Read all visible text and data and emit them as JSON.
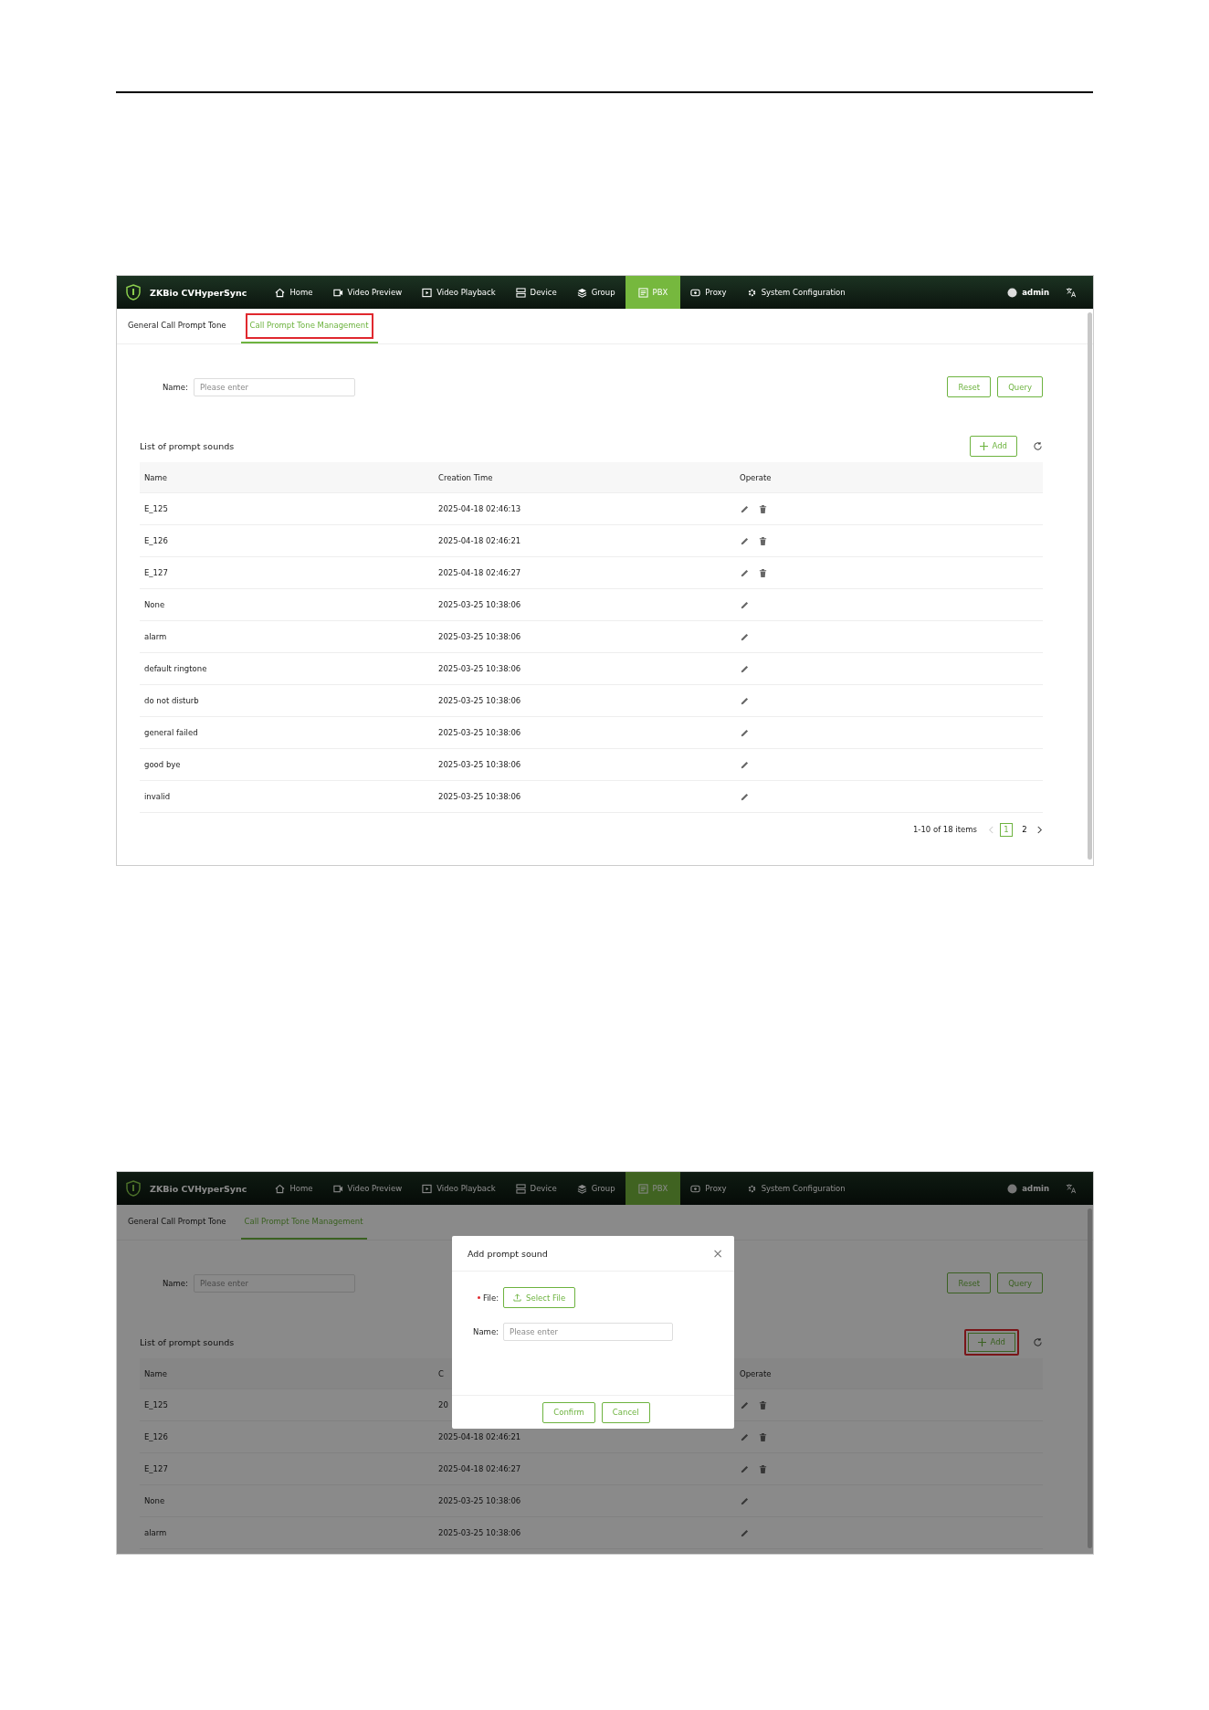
{
  "screens": [
    {
      "brand": "ZKBio CVHyperSync",
      "user": "admin",
      "overlay": false,
      "nav": [
        {
          "label": "Home",
          "selected": false
        },
        {
          "label": "Video Preview",
          "selected": false
        },
        {
          "label": "Video Playback",
          "selected": false
        },
        {
          "label": "Device",
          "selected": false
        },
        {
          "label": "Group",
          "selected": false
        },
        {
          "label": "PBX",
          "selected": true
        },
        {
          "label": "Proxy",
          "selected": false
        },
        {
          "label": "System Configuration",
          "selected": false
        }
      ],
      "tabs": [
        {
          "label": "General Call Prompt Tone",
          "selected": false,
          "highlighted": false
        },
        {
          "label": "Call Prompt Tone Management",
          "selected": true,
          "highlighted": true
        }
      ],
      "filter": {
        "label": "Name:",
        "placeholder": "Please enter"
      },
      "buttons": [
        "Reset",
        "Query"
      ],
      "list_title": "List of prompt sounds",
      "add_button": {
        "label": "Add",
        "highlighted": false
      },
      "columns": [
        "Name",
        "Creation Time",
        "Operate"
      ],
      "rows": [
        {
          "name": "E_125",
          "creation_time": "2025-04-18 02:46:13",
          "deletable": true
        },
        {
          "name": "E_126",
          "creation_time": "2025-04-18 02:46:21",
          "deletable": true
        },
        {
          "name": "E_127",
          "creation_time": "2025-04-18 02:46:27",
          "deletable": true
        },
        {
          "name": "None",
          "creation_time": "2025-03-25 10:38:06",
          "deletable": false
        },
        {
          "name": "alarm",
          "creation_time": "2025-03-25 10:38:06",
          "deletable": false
        },
        {
          "name": "default ringtone",
          "creation_time": "2025-03-25 10:38:06",
          "deletable": false
        },
        {
          "name": "do not disturb",
          "creation_time": "2025-03-25 10:38:06",
          "deletable": false
        },
        {
          "name": "general failed",
          "creation_time": "2025-03-25 10:38:06",
          "deletable": false
        },
        {
          "name": "good bye",
          "creation_time": "2025-03-25 10:38:06",
          "deletable": false
        },
        {
          "name": "invalid",
          "creation_time": "2025-03-25 10:38:06",
          "deletable": false
        }
      ],
      "pagination": {
        "summary": "1-10 of 18 items",
        "pages": [
          {
            "label": "1",
            "selected": true
          },
          {
            "label": "2",
            "selected": false
          }
        ]
      }
    },
    {
      "brand": "ZKBio CVHyperSync",
      "user": "admin",
      "overlay": true,
      "nav": [
        {
          "label": "Home",
          "selected": false
        },
        {
          "label": "Video Preview",
          "selected": false
        },
        {
          "label": "Video Playback",
          "selected": false
        },
        {
          "label": "Device",
          "selected": false
        },
        {
          "label": "Group",
          "selected": false
        },
        {
          "label": "PBX",
          "selected": true
        },
        {
          "label": "Proxy",
          "selected": false
        },
        {
          "label": "System Configuration",
          "selected": false
        }
      ],
      "tabs": [
        {
          "label": "General Call Prompt Tone",
          "selected": false,
          "highlighted": false
        },
        {
          "label": "Call Prompt Tone Management",
          "selected": true,
          "highlighted": false
        }
      ],
      "filter": {
        "label": "Name:",
        "placeholder": "Please enter"
      },
      "buttons": [
        "Reset",
        "Query"
      ],
      "list_title": "List of prompt sounds",
      "add_button": {
        "label": "Add",
        "highlighted": true
      },
      "columns": [
        "Name",
        "C",
        "Operate"
      ],
      "rows": [
        {
          "name": "E_125",
          "creation_time": "20",
          "deletable": true
        },
        {
          "name": "E_126",
          "creation_time": "2025-04-18 02:46:21",
          "deletable": true
        },
        {
          "name": "E_127",
          "creation_time": "2025-04-18 02:46:27",
          "deletable": true
        },
        {
          "name": "None",
          "creation_time": "2025-03-25 10:38:06",
          "deletable": false
        },
        {
          "name": "alarm",
          "creation_time": "2025-03-25 10:38:06",
          "deletable": false
        }
      ],
      "dialog": {
        "title": "Add prompt sound",
        "close": "×",
        "fields": [
          {
            "kind": "file",
            "required": true,
            "label": "File:",
            "button": "Select File"
          },
          {
            "kind": "text",
            "required": false,
            "label": "Name:",
            "placeholder": "Please enter"
          }
        ],
        "buttons": [
          "Confirm",
          "Cancel"
        ]
      }
    }
  ]
}
